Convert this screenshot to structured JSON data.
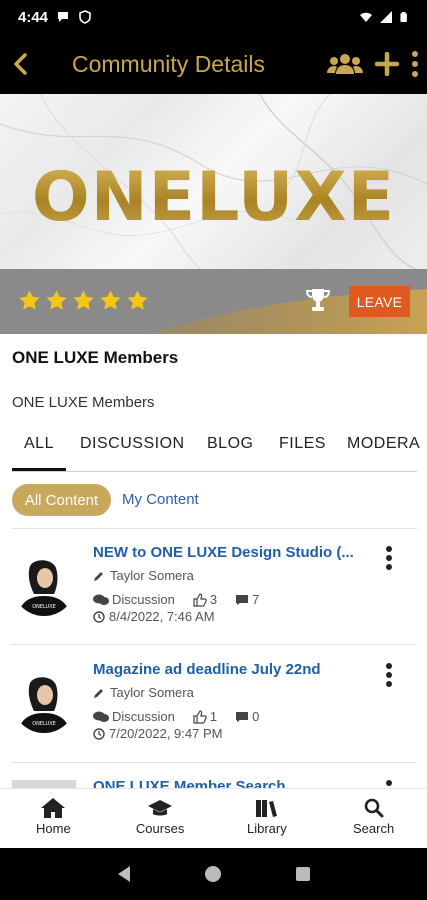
{
  "status_bar": {
    "time": "4:44"
  },
  "app_bar": {
    "title": "Community Details"
  },
  "banner": {
    "logo_text": "ONELUXE",
    "rating": 5,
    "leave_label": "LEAVE"
  },
  "community": {
    "title": "ONE LUXE Members",
    "description": "ONE LUXE Members"
  },
  "tabs": [
    {
      "label": "ALL",
      "active": true
    },
    {
      "label": "DISCUSSION",
      "active": false
    },
    {
      "label": "BLOG",
      "active": false
    },
    {
      "label": "FILES",
      "active": false
    },
    {
      "label": "MODERA",
      "active": false
    }
  ],
  "filters": {
    "all_content": "All Content",
    "my_content": "My Content"
  },
  "posts": [
    {
      "title": "NEW to ONE LUXE Design Studio (...",
      "author": "Taylor Somera",
      "type": "Discussion",
      "likes": "3",
      "comments": "7",
      "date": "8/4/2022, 7:46 AM"
    },
    {
      "title": "Magazine ad deadline July 22nd",
      "author": "Taylor Somera",
      "type": "Discussion",
      "likes": "1",
      "comments": "0",
      "date": "7/20/2022, 9:47 PM"
    },
    {
      "title": "ONE LUXE Member Search"
    }
  ],
  "bottom_nav": [
    {
      "label": "Home",
      "icon": "home-icon"
    },
    {
      "label": "Courses",
      "icon": "graduation-cap-icon"
    },
    {
      "label": "Library",
      "icon": "books-icon"
    },
    {
      "label": "Search",
      "icon": "search-icon"
    }
  ],
  "colors": {
    "gold": "#c9a752",
    "chip": "#c7a85c",
    "leave": "#e05a1f",
    "link": "#1f5fa6",
    "star": "#f5c518"
  }
}
